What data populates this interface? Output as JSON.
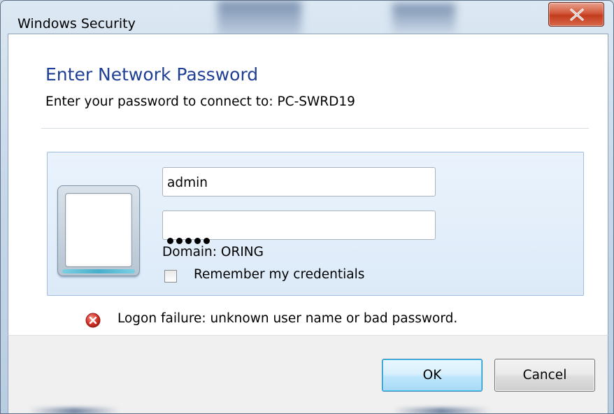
{
  "window": {
    "title": "Windows Security",
    "close_label": "X"
  },
  "dialog": {
    "heading": "Enter Network Password",
    "subheading": "Enter your password to connect to: PC-SWRD19"
  },
  "credentials": {
    "username_value": "admin",
    "password_value": "•••••",
    "domain_text": "Domain: ORING",
    "remember_label": "Remember my credentials",
    "remember_checked": false
  },
  "error": {
    "message": "Logon failure: unknown user name or bad password.",
    "icon": "error-icon"
  },
  "buttons": {
    "ok_label": "OK",
    "cancel_label": "Cancel"
  },
  "colors": {
    "heading": "#1e3f93",
    "error_icon": "#d9362b",
    "close_button": "#c23c1c"
  }
}
